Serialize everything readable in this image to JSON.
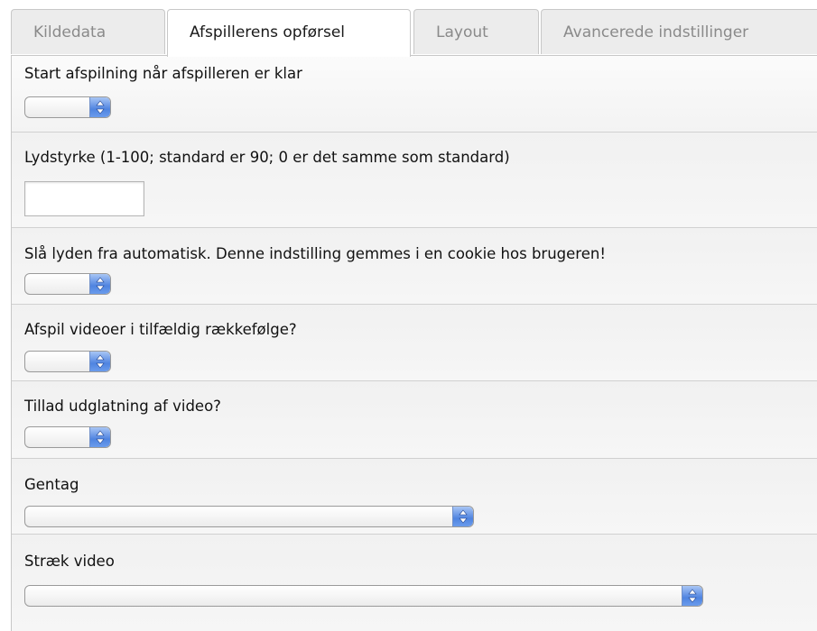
{
  "tabs": [
    {
      "label": "Kildedata",
      "active": false
    },
    {
      "label": "Afspillerens opførsel",
      "active": true
    },
    {
      "label": "Layout",
      "active": false
    },
    {
      "label": "Avancerede indstillinger",
      "active": false
    }
  ],
  "fields": {
    "autostart": {
      "label": "Start afspilning når afspilleren er klar",
      "value": ""
    },
    "volume": {
      "label": "Lydstyrke (1-100; standard er 90; 0 er det samme som standard)",
      "value": "",
      "placeholder": ""
    },
    "mute": {
      "label": "Slå lyden fra automatisk. Denne indstilling gemmes i en cookie hos brugeren!",
      "value": ""
    },
    "shuffle": {
      "label": "Afspil videoer i tilfældig rækkefølge?",
      "value": ""
    },
    "smoothing": {
      "label": "Tillad udglatning af video?",
      "value": ""
    },
    "repeat": {
      "label": "Gentag",
      "value": ""
    },
    "stretch": {
      "label": "Stræk video",
      "value": ""
    }
  },
  "icons": {
    "select_arrows": "updown-arrows-icon"
  },
  "colors": {
    "select_arrow_blue": "#4f84e0",
    "panel_bg": "#f3f3f3",
    "border": "#c8c8c8"
  }
}
